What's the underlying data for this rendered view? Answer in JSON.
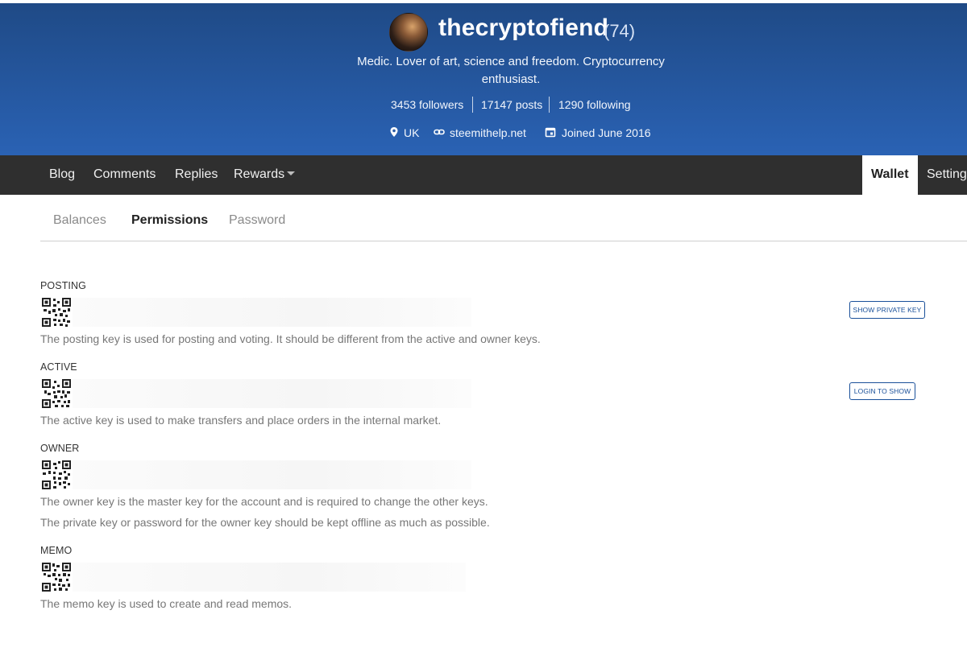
{
  "profile": {
    "username": "thecryptofiend",
    "reputation": "(74)",
    "bio": "Medic. Lover of art, science and freedom. Cryptocurrency enthusiast.",
    "followers": "3453 followers",
    "posts": "17147 posts",
    "following": "1290 following",
    "location": "UK",
    "website": "steemithelp.net",
    "joined": "Joined June 2016",
    "colors": {
      "hero_top": "#1f4a86",
      "hero_bottom": "#2a62b4"
    }
  },
  "nav": {
    "blog": "Blog",
    "comments": "Comments",
    "replies": "Replies",
    "rewards": "Rewards",
    "wallet": "Wallet",
    "settings": "Settings",
    "bg_color": "#2f2f2f"
  },
  "subtabs": {
    "balances": "Balances",
    "permissions": "Permissions",
    "password": "Password"
  },
  "keys": {
    "posting": {
      "label": "POSTING",
      "description": "The posting key is used for posting and voting. It should be different from the active and owner keys.",
      "button": "SHOW PRIVATE KEY"
    },
    "active": {
      "label": "ACTIVE",
      "description": "The active key is used to make transfers and place orders in the internal market.",
      "button": "LOGIN TO SHOW"
    },
    "owner": {
      "label": "OWNER",
      "description": "The owner key is the master key for the account and is required to change the other keys.",
      "description2": "The private key or password for the owner key should be kept offline as much as possible."
    },
    "memo": {
      "label": "MEMO",
      "description": "The memo key is used to create and read memos."
    }
  },
  "icons": {
    "location": "map-pin-icon",
    "website": "link-icon",
    "joined": "calendar-icon",
    "qr": "qr-code-icon",
    "rewards_caret": "caret-down-icon"
  },
  "accent": "#1a5099"
}
